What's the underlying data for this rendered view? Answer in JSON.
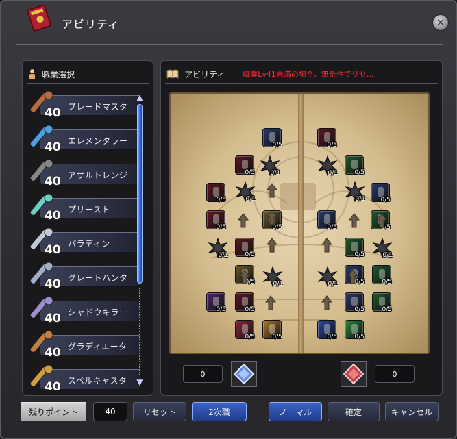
{
  "window": {
    "title": "アビリティ"
  },
  "left_panel": {
    "header": "職業選択",
    "jobs": [
      {
        "name": "ブレードマスタ",
        "level": "40",
        "icon": "sword-icon"
      },
      {
        "name": "エレメンタラー",
        "level": "40",
        "icon": "orb-staff-icon"
      },
      {
        "name": "アサルトレンジ",
        "level": "40",
        "icon": "gun-icon"
      },
      {
        "name": "プリースト",
        "level": "40",
        "icon": "healing-staff-icon"
      },
      {
        "name": "パラディン",
        "level": "40",
        "icon": "shield-icon"
      },
      {
        "name": "グレートハンタ",
        "level": "40",
        "icon": "bow-icon"
      },
      {
        "name": "シャドウキラー",
        "level": "40",
        "icon": "scythe-icon"
      },
      {
        "name": "グラディエータ",
        "level": "40",
        "icon": "hammer-icon"
      },
      {
        "name": "スペルキャスタ",
        "level": "40",
        "icon": "spellbook-icon"
      }
    ]
  },
  "right_panel": {
    "header": "アビリティ",
    "warning": "職業Lv41未満の場合、無条件でリセ..."
  },
  "nodes": [
    {
      "count": "0/5",
      "color": "#2a3a6a"
    },
    {
      "count": "0/5",
      "color": "#5a1a22"
    },
    {
      "count": "0/5",
      "color": "#5a1a22"
    },
    {
      "count": "0/1",
      "color": "#2a2a2a"
    },
    {
      "count": "0/1",
      "color": "#2a2a2a"
    },
    {
      "count": "0/5",
      "color": "#1f5a2a"
    },
    {
      "count": "0/5",
      "color": "#5a1a22"
    },
    {
      "count": "0/1",
      "color": "#2a2a2a"
    },
    {
      "count": "0/1",
      "color": "#2a2a2a"
    },
    {
      "count": "0/5",
      "color": "#2a3a6a"
    },
    {
      "count": "0/5",
      "color": "#5a1a22"
    },
    {
      "count": "0/5",
      "color": "#6a5a2a"
    },
    {
      "count": "0/5",
      "color": "#2a3a6a"
    },
    {
      "count": "0/5",
      "color": "#1f5a2a"
    },
    {
      "count": "0/1",
      "color": "#2a2a2a"
    },
    {
      "count": "0/5",
      "color": "#5a1a22"
    },
    {
      "count": "0/5",
      "color": "#1f5a2a"
    },
    {
      "count": "0/1",
      "color": "#2a2a2a"
    },
    {
      "count": "0/5",
      "color": "#6a5a2a"
    },
    {
      "count": "0/1",
      "color": "#2a2a2a"
    },
    {
      "count": "0/1",
      "color": "#2a2a2a"
    },
    {
      "count": "0/5",
      "color": "#2a3a6a"
    },
    {
      "count": "0/5",
      "color": "#1f5a2a"
    },
    {
      "count": "0/5",
      "color": "#4a2a6a"
    },
    {
      "count": "0/5",
      "color": "#5a1a22"
    },
    {
      "count": "0/5",
      "color": "#2a3a6a"
    },
    {
      "count": "0/5",
      "color": "#1f5a2a"
    },
    {
      "count": "0/5",
      "color": "#8a2a3a"
    },
    {
      "count": "0/5",
      "color": "#b07a2a"
    },
    {
      "count": "0/5",
      "color": "#2a4aa0"
    },
    {
      "count": "0/5",
      "color": "#2a8a3a"
    }
  ],
  "element_points": {
    "left_value": "0",
    "right_value": "0",
    "left_icon": "water-crystal-icon",
    "right_icon": "fire-crystal-icon"
  },
  "bottom_bar": {
    "remaining_label": "残りポイント",
    "remaining_value": "40",
    "reset": "リセット",
    "second_job": "2次職",
    "normal": "ノーマル",
    "confirm": "確定",
    "cancel": "キャンセル"
  }
}
